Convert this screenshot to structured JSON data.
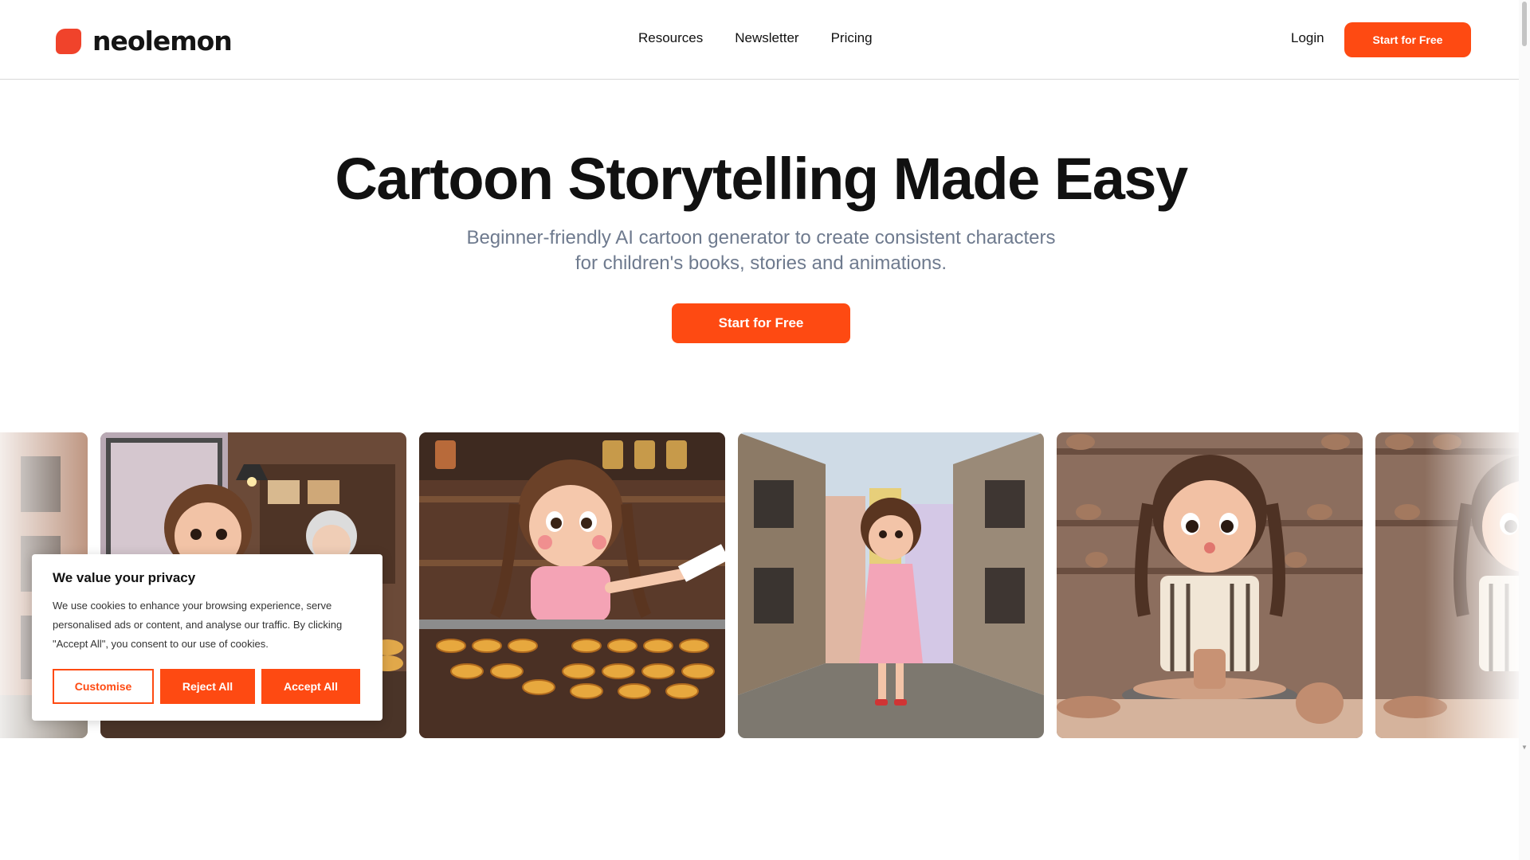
{
  "brand": {
    "name": "neolemon",
    "accent": "#fe4a12"
  },
  "nav": {
    "items": [
      {
        "label": "Resources"
      },
      {
        "label": "Newsletter"
      },
      {
        "label": "Pricing"
      }
    ],
    "login_label": "Login",
    "cta_label": "Start for Free"
  },
  "hero": {
    "title": "Cartoon Storytelling Made Easy",
    "subtitle_line1": "Beginner-friendly AI cartoon generator to create consistent characters",
    "subtitle_line2": "for children's books, stories and animations.",
    "cta_label": "Start for Free"
  },
  "gallery": {
    "scenes": [
      "street",
      "bakery-counter",
      "pastry-shop",
      "cobblestone-street",
      "pottery-studio",
      "pottery-studio-partial"
    ]
  },
  "cookie_banner": {
    "title": "We value your privacy",
    "body": "We use cookies to enhance your browsing experience, serve personalised ads or content, and analyse our traffic. By clicking \"Accept All\", you consent to our use of cookies.",
    "customise_label": "Customise",
    "reject_label": "Reject All",
    "accept_label": "Accept All"
  }
}
